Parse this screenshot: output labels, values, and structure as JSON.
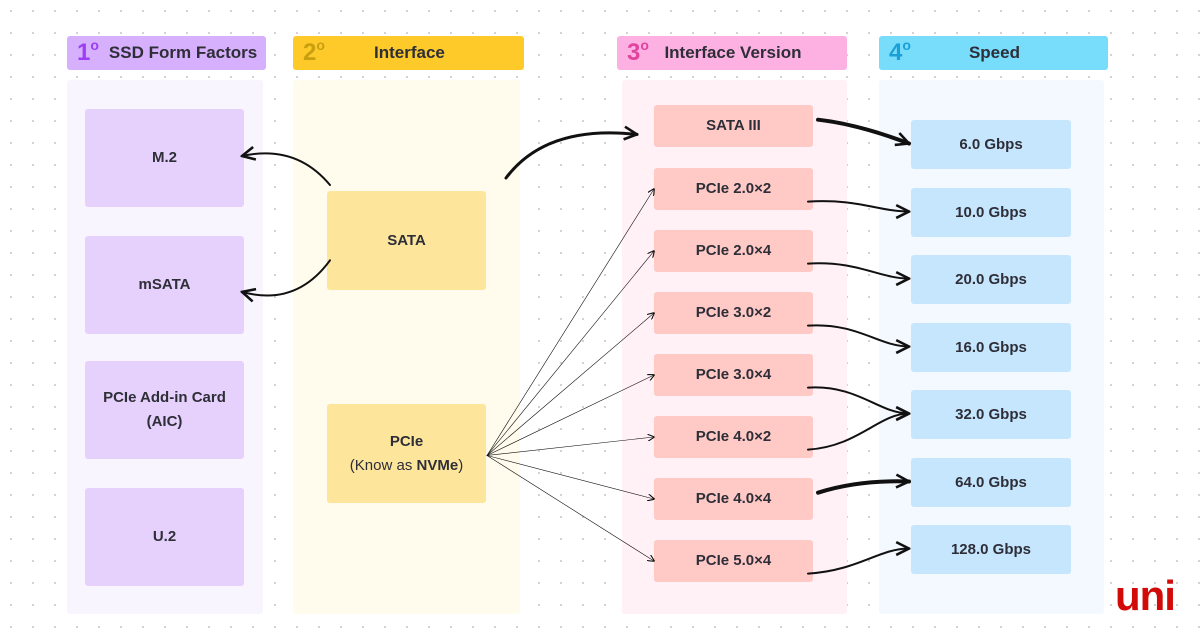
{
  "columns": [
    {
      "id": "c1",
      "number": "1",
      "title": "SSD Form Factors",
      "header_color": "#d7b0fd",
      "number_color": "#9b3ef5",
      "panel_color": "#f8f5fe",
      "box_color": "#e6d1fc",
      "items": [
        {
          "id": "m2",
          "label": "M.2"
        },
        {
          "id": "msata",
          "label": "mSATA"
        },
        {
          "id": "aic",
          "label": "PCIe Add-in Card",
          "sub": "(AIC)"
        },
        {
          "id": "u2",
          "label": "U.2"
        }
      ]
    },
    {
      "id": "c2",
      "number": "2",
      "title": "Interface",
      "header_color": "#fdca2a",
      "number_color": "#c8a00f",
      "panel_color": "#fffbed",
      "box_color": "#fde69c",
      "items": [
        {
          "id": "sata",
          "label": "SATA"
        },
        {
          "id": "pcie",
          "label": "PCIe",
          "sub_prefix": "(Know as ",
          "sub_bold": "NVMe",
          "sub_suffix": ")"
        }
      ]
    },
    {
      "id": "c3",
      "number": "3",
      "title": "Interface Version",
      "header_color": "#fdb1e2",
      "number_color": "#e0449f",
      "panel_color": "#fff1f6",
      "box_color": "#ffc9c5",
      "items": [
        {
          "id": "sata3",
          "label": "SATA III"
        },
        {
          "id": "p22",
          "label": "PCIe 2.0×2"
        },
        {
          "id": "p24",
          "label": "PCIe 2.0×4"
        },
        {
          "id": "p32",
          "label": "PCIe 3.0×2"
        },
        {
          "id": "p34",
          "label": "PCIe 3.0×4"
        },
        {
          "id": "p42",
          "label": "PCIe 4.0×2"
        },
        {
          "id": "p44",
          "label": "PCIe 4.0×4"
        },
        {
          "id": "p54",
          "label": "PCIe 5.0×4"
        }
      ]
    },
    {
      "id": "c4",
      "number": "4",
      "title": "Speed",
      "header_color": "#78dcfb",
      "number_color": "#1a9fd6",
      "panel_color": "#f3f9fe",
      "box_color": "#c6e6fe",
      "items": [
        {
          "id": "s6",
          "label": "6.0 Gbps"
        },
        {
          "id": "s10",
          "label": "10.0 Gbps"
        },
        {
          "id": "s20",
          "label": "20.0 Gbps"
        },
        {
          "id": "s16",
          "label": "16.0 Gbps"
        },
        {
          "id": "s32",
          "label": "32.0 Gbps"
        },
        {
          "id": "s64",
          "label": "64.0 Gbps"
        },
        {
          "id": "s128",
          "label": "128.0 Gbps"
        }
      ]
    }
  ],
  "connections": [
    {
      "from": "sata",
      "to": "m2",
      "style": "medium"
    },
    {
      "from": "sata",
      "to": "msata",
      "style": "medium"
    },
    {
      "from": "sata",
      "to": "sata3",
      "style": "medium"
    },
    {
      "from": "pcie",
      "to": "p22",
      "style": "thin"
    },
    {
      "from": "pcie",
      "to": "p24",
      "style": "thin"
    },
    {
      "from": "pcie",
      "to": "p32",
      "style": "thin"
    },
    {
      "from": "pcie",
      "to": "p34",
      "style": "thin"
    },
    {
      "from": "pcie",
      "to": "p42",
      "style": "thin"
    },
    {
      "from": "pcie",
      "to": "p44",
      "style": "thin"
    },
    {
      "from": "pcie",
      "to": "p54",
      "style": "thin"
    },
    {
      "from": "sata3",
      "to": "s6",
      "style": "bold"
    },
    {
      "from": "p22",
      "to": "s10",
      "style": "medium"
    },
    {
      "from": "p24",
      "to": "s20",
      "style": "medium"
    },
    {
      "from": "p32",
      "to": "s16",
      "style": "medium"
    },
    {
      "from": "p34",
      "to": "s32",
      "style": "medium"
    },
    {
      "from": "p42",
      "to": "s32",
      "style": "medium"
    },
    {
      "from": "p44",
      "to": "s64",
      "style": "bold"
    },
    {
      "from": "p54",
      "to": "s128",
      "style": "medium"
    }
  ],
  "logo": {
    "text": "uni",
    "color": "#d20a0a"
  }
}
